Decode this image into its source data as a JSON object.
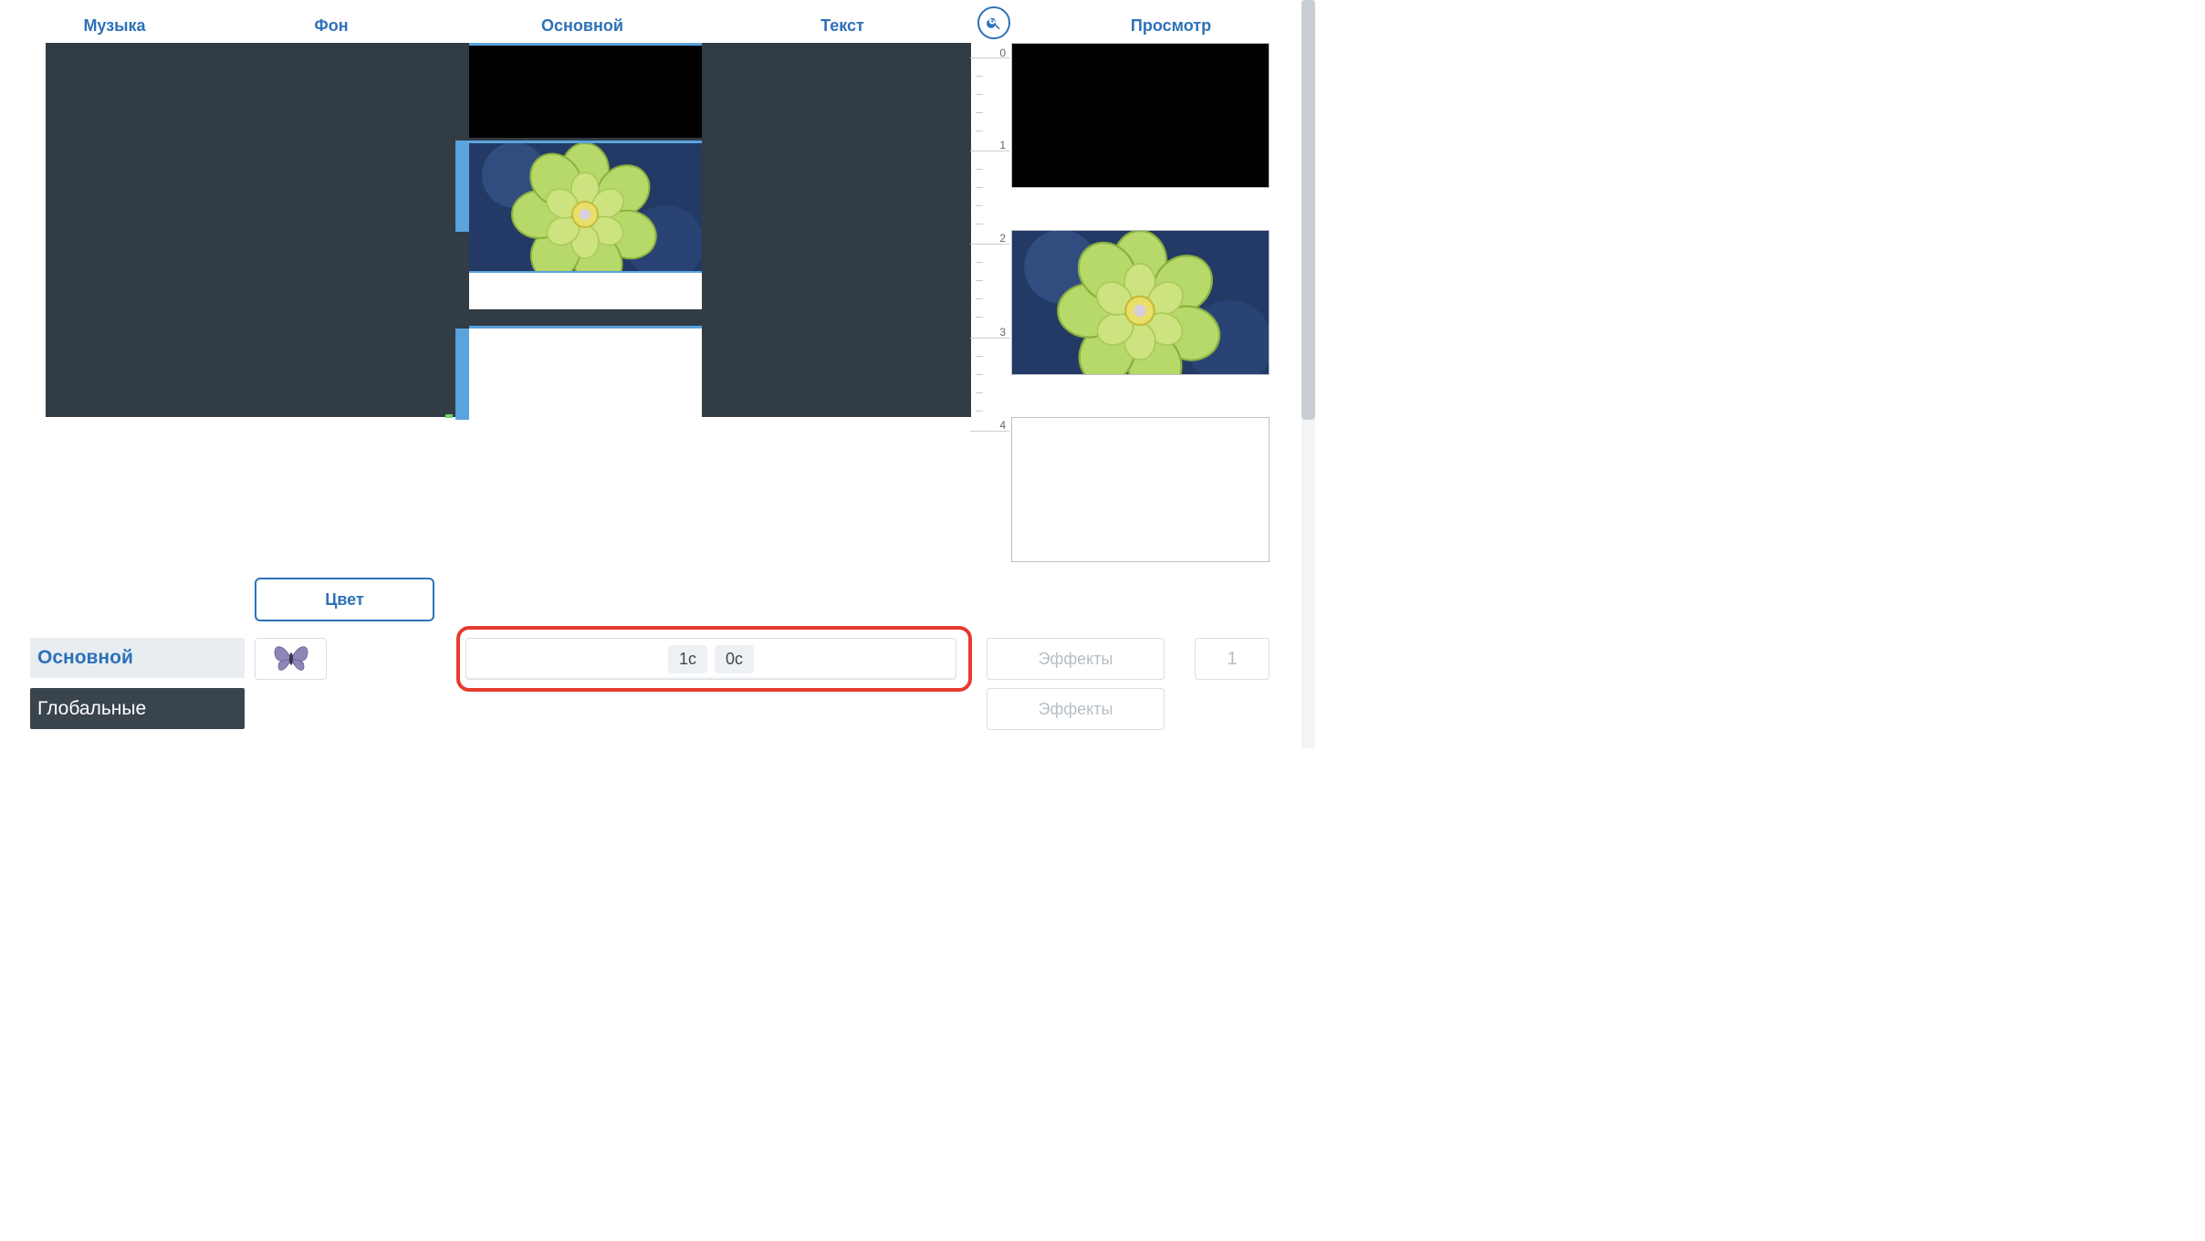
{
  "tabs": {
    "music": "Музыка",
    "background": "Фон",
    "main": "Основной",
    "text": "Текст",
    "view": "Просмотр"
  },
  "ruler": {
    "labels": [
      "0",
      "1",
      "2",
      "3",
      "4"
    ]
  },
  "lower": {
    "color_button": "Цвет",
    "category_main": "Основной",
    "category_global": "Глобальные",
    "chip1": "1с",
    "chip2": "0с",
    "effects_label": "Эффекты",
    "numbox": "1"
  },
  "icons": {
    "zoom": "zoom-in-icon",
    "butterfly": "butterfly-icon"
  },
  "colors": {
    "accent": "#2e71b8",
    "highlight": "#e63b2e"
  }
}
